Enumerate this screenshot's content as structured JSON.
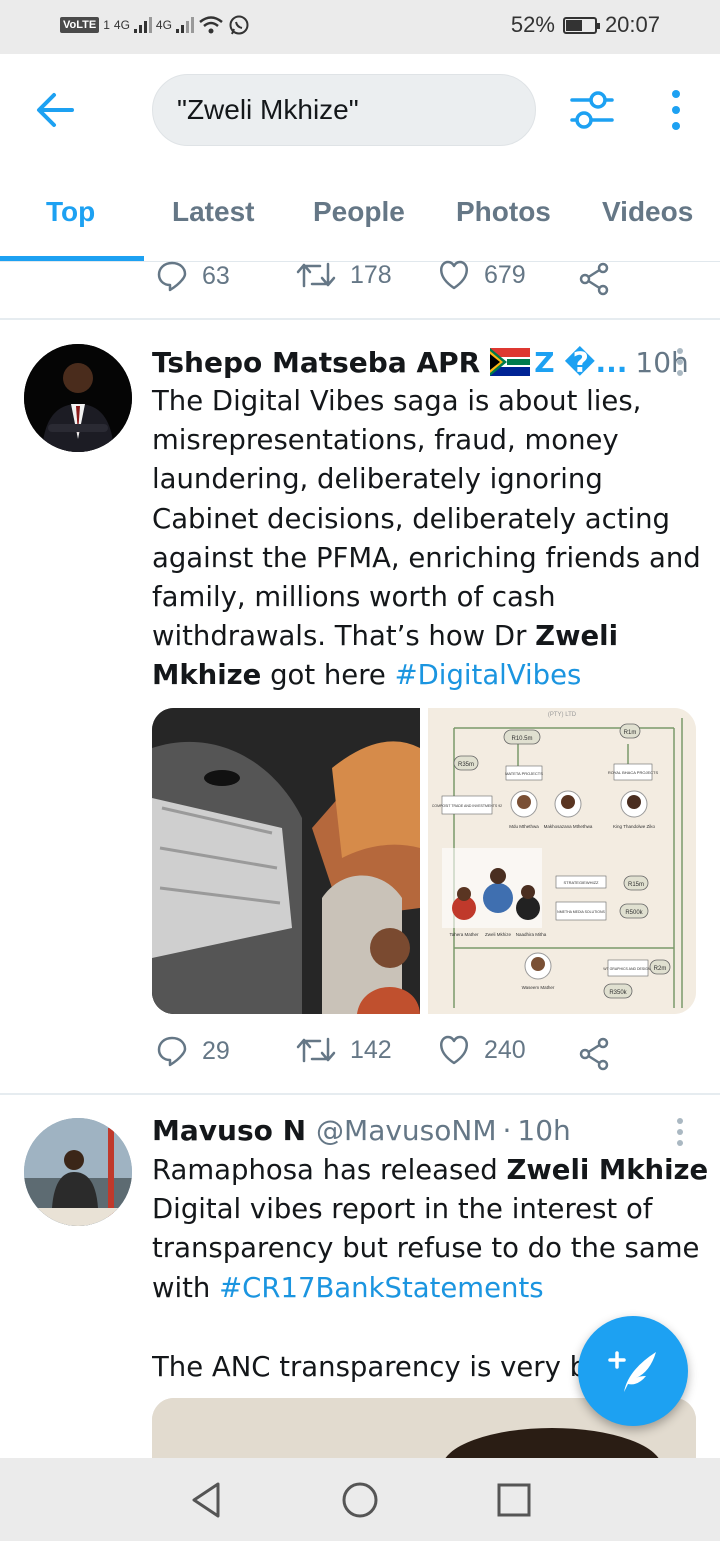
{
  "status_bar": {
    "network_badge": "VoLTE",
    "sim_number": "1",
    "signal_1": "4G",
    "signal_2": "4G",
    "battery_percent": "52%",
    "battery_level": 0.52,
    "time": "20:07",
    "icons": [
      "signal-icon",
      "wifi-icon",
      "whatsapp-icon",
      "battery-icon"
    ]
  },
  "top_bar": {
    "back_icon": "arrow-left-icon",
    "search_query": "\"Zweli Mkhize\"",
    "filter_icon": "search-filter-icon",
    "more_icon": "vertical-ellipsis-icon"
  },
  "tabs": [
    {
      "label": "Top",
      "active": true
    },
    {
      "label": "Latest",
      "active": false
    },
    {
      "label": "People",
      "active": false
    },
    {
      "label": "Photos",
      "active": false
    },
    {
      "label": "Videos",
      "active": false
    }
  ],
  "accent_color": "#1da1f2",
  "prev_tweet_actions": {
    "replies": "63",
    "retweets": "178",
    "likes": "679"
  },
  "tweets": [
    {
      "name": "Tshepo Matseba APR",
      "name_extra": "Z �...",
      "handle": "",
      "time": "10h",
      "text_parts": [
        "The Digital Vibes saga is about lies, misrepresentations, fraud, money laundering, deliberately ignoring Cabinet decisions, deliberately acting against the PFMA, enriching friends and family, millions worth of cash withdrawals. That’s how Dr ",
        "Zweli Mkhize",
        " got here ",
        "#DigitalVibes"
      ],
      "media_right_labels": {
        "pty": "(PTY) LTD",
        "r105": "R10.5m",
        "r1m": "R1m",
        "r35m": "R35m",
        "mateta": "MATETA PROJECTS",
        "royal": "ROYAL BHACA PROJECTS",
        "composit": "COMPOSIT TRADE AND INVESTMENTS 92",
        "mdu": "Mdu Mthethwa",
        "makhosazana": "Makhosazana Mthethwa",
        "king": "King Thandolwe Ziko",
        "strategiewhizz": "STRATEGIEWHIZZ",
        "r15m": "R15m",
        "nmetha": "NMETHA MEDIA SOLUTIONS",
        "r500k": "R500k",
        "tahera": "Tahera Mather",
        "zweli": "Zweli Mkhize",
        "naadhira": "Naadhira Mitha",
        "wt": "WT GRAPHICS AND DESIGNS",
        "r2m": "R2m",
        "waseem": "Waseem Mather",
        "r350k": "R350k"
      },
      "actions": {
        "replies": "29",
        "retweets": "142",
        "likes": "240"
      }
    },
    {
      "name": "Mavuso N",
      "handle": "@MavusoNM",
      "time": "10h",
      "text_parts": [
        "Ramaphosa has released ",
        "Zweli Mkhize",
        " Digital vibes report in the interest of transparency but refuse to do the same with ",
        "#CR17BankStatements",
        "The ANC transparency is very b"
      ]
    }
  ],
  "fab": {
    "icon": "compose-tweet-icon"
  },
  "nav_bar": {
    "icons": [
      "back-triangle-icon",
      "home-circle-icon",
      "recents-square-icon"
    ]
  }
}
